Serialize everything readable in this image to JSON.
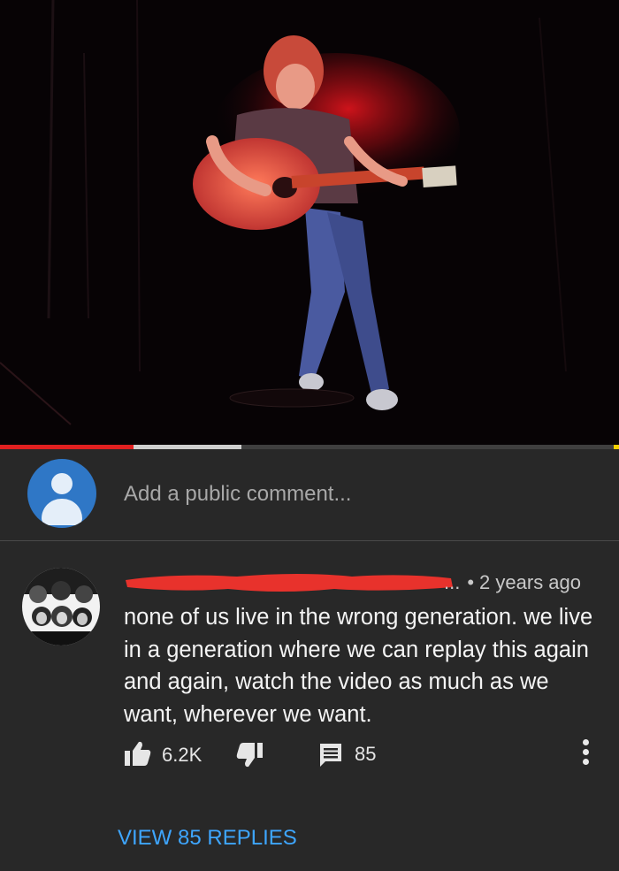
{
  "video": {
    "progress_played": 0.215,
    "progress_buffered": 0.39
  },
  "add_comment": {
    "placeholder": "Add a public comment..."
  },
  "comment": {
    "author_redacted": true,
    "meta_ellipsis": "...",
    "time": "2 years ago",
    "text": "none of us live in the wrong generation. we live in a generation where we can replay this again and again, watch the video as much as we want, wherever we want.",
    "likes": "6.2K",
    "replies_count": "85",
    "view_replies_label": "VIEW 85 REPLIES"
  },
  "colors": {
    "background": "#282828",
    "accent_link": "#3ea6ff",
    "progress_played": "#e02020",
    "redaction": "#e8322c",
    "avatar_default": "#2f77c6"
  },
  "icons": [
    "thumbs-up-icon",
    "thumbs-down-icon",
    "reply-icon",
    "more-vert-icon",
    "default-user-icon"
  ]
}
